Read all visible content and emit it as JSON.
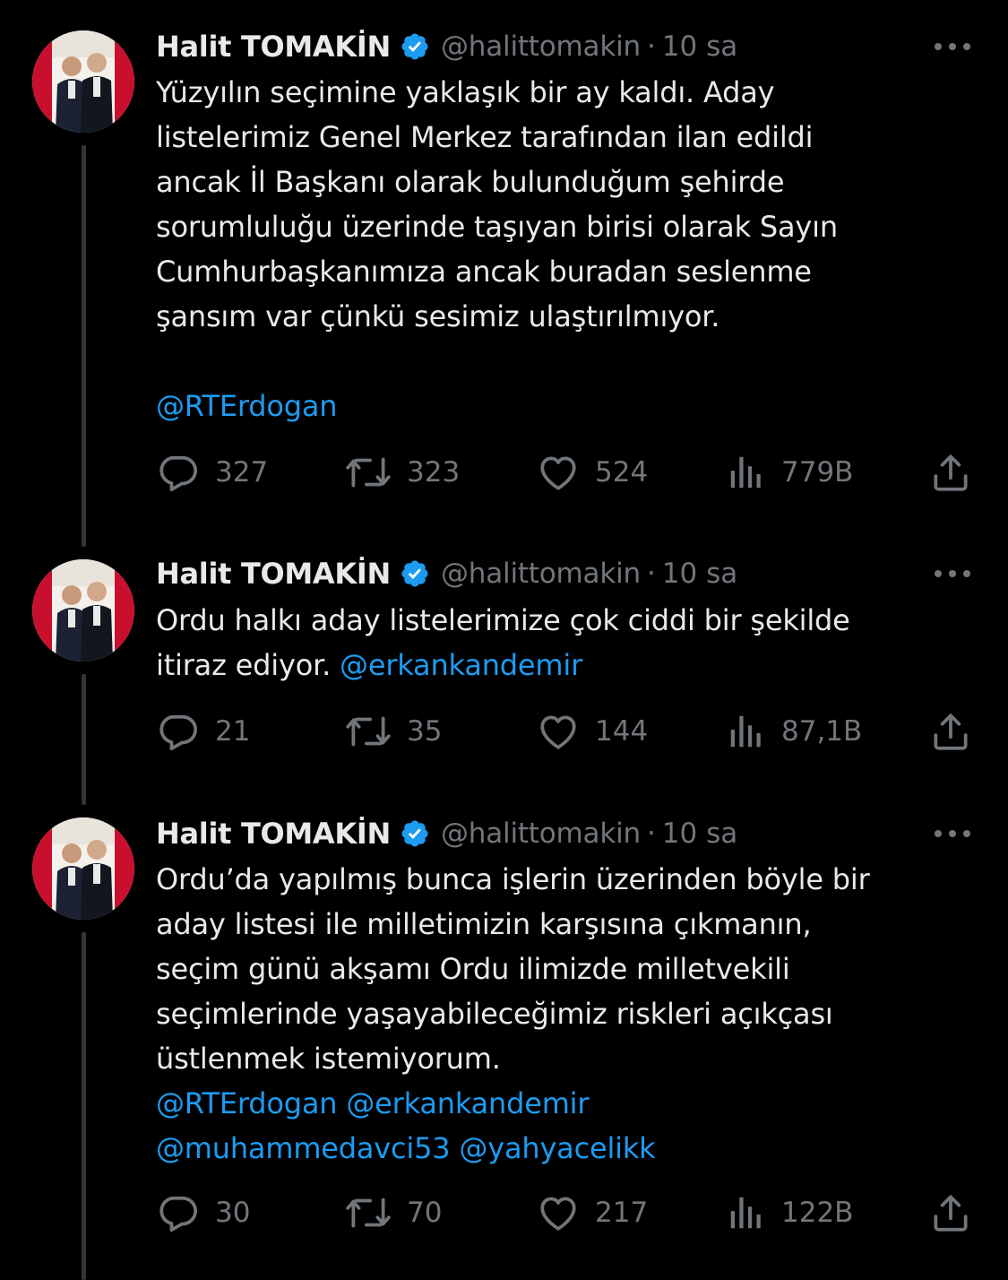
{
  "colors": {
    "background": "#000000",
    "text": "#e7e9ea",
    "secondary": "#71767b",
    "accent": "#1d9bf0",
    "thread_line": "#333639"
  },
  "tweets": [
    {
      "author": {
        "name": "Halit TOMAKİN",
        "handle": "@halittomakin",
        "time": "10 sa",
        "separator": "·",
        "verified_icon": "verified-badge-icon"
      },
      "body": {
        "text": "Yüzyılın seçimine yaklaşık bir ay kaldı. Aday\nlistelerimiz Genel Merkez tarafından ilan edildi\nancak İl Başkanı olarak bulunduğum şehirde\nsorumluluğu üzerinde taşıyan birisi olarak Sayın\nCumhurbaşkanımıza ancak buradan seslenme\nşansım var çünkü sesimiz ulaştırılmıyor.\n\n",
        "mentions_line": "@RTErdogan"
      },
      "stats": {
        "replies": "327",
        "retweets": "323",
        "likes": "524",
        "views": "779B"
      }
    },
    {
      "author": {
        "name": "Halit TOMAKİN",
        "handle": "@halittomakin",
        "time": "10 sa",
        "separator": "·",
        "verified_icon": "verified-badge-icon"
      },
      "body": {
        "text": "Ordu halkı aday listelerimize çok ciddi bir şekilde\nitiraz ediyor. ",
        "mentions_line": "@erkankandemir"
      },
      "stats": {
        "replies": "21",
        "retweets": "35",
        "likes": "144",
        "views": "87,1B"
      }
    },
    {
      "author": {
        "name": "Halit TOMAKİN",
        "handle": "@halittomakin",
        "time": "10 sa",
        "separator": "·",
        "verified_icon": "verified-badge-icon"
      },
      "body": {
        "text": "Ordu’da yapılmış bunca işlerin üzerinden böyle bir\naday listesi ile milletimizin karşısına çıkmanın,\nseçim günü akşamı Ordu ilimizde milletvekili\nseçimlerinde yaşayabileceğimiz riskleri açıkçası\nüstlenmek istemiyorum.\n",
        "mentions_line": "@RTErdogan @erkankandemir\n@muhammedavci53 @yahyacelikk"
      },
      "stats": {
        "replies": "30",
        "retweets": "70",
        "likes": "217",
        "views": "122B"
      }
    }
  ],
  "icons": {
    "reply": "reply-bubble-icon",
    "retweet": "retweet-arrows-icon",
    "like": "heart-icon",
    "views": "bar-chart-icon",
    "share": "share-upload-icon",
    "more": "more-dots-icon",
    "avatar": "profile-avatar"
  }
}
